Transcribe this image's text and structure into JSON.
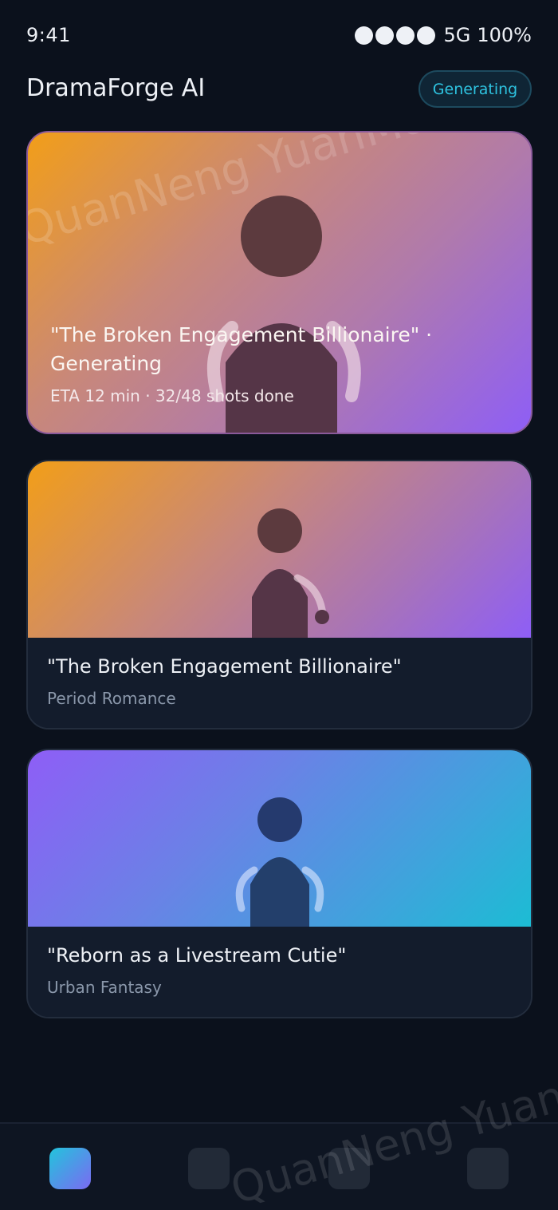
{
  "status_bar": {
    "time": "9:41",
    "network": "5G",
    "battery": "100%"
  },
  "header": {
    "title": "DramaForge AI",
    "badge": "Generating"
  },
  "hero": {
    "title": "\"The Broken Engagement Billionaire\" · Generating",
    "meta": "ETA 12 min · 32/48 shots done"
  },
  "dramas": [
    {
      "title": "\"The Broken Engagement Billionaire\"",
      "genre": "Period Romance"
    },
    {
      "title": "\"Reborn as a Livestream Cutie\"",
      "genre": "Urban Fantasy"
    }
  ],
  "watermark": {
    "top": "QuanNeng YuanMa · in",
    "bottom": "QuanNeng YuanMa"
  },
  "colors": {
    "background": "#0b111c",
    "accent": "#2ec3e0",
    "warm_gradient": [
      "#f29e18",
      "#8e5ef6"
    ],
    "cool_gradient": [
      "#8e5ef6",
      "#1cbcd4"
    ]
  },
  "bottom_nav": {
    "tabs": [
      {
        "icon": "home-icon",
        "active": true
      },
      {
        "icon": "tab-icon",
        "active": false
      },
      {
        "icon": "tab-icon",
        "active": false
      },
      {
        "icon": "tab-icon",
        "active": false
      }
    ]
  }
}
